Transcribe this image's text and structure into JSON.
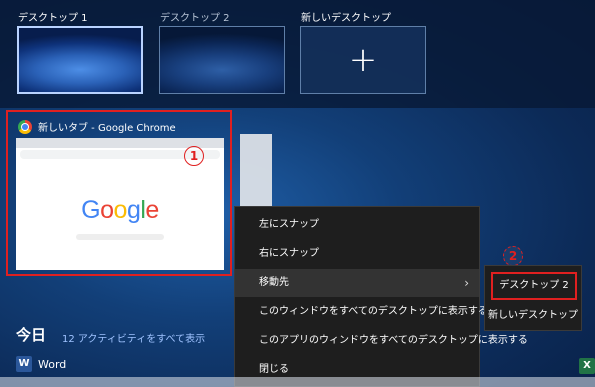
{
  "desktops": [
    {
      "label": "デスクトップ 1"
    },
    {
      "label": "デスクトップ 2"
    },
    {
      "label": "新しいデスクトップ",
      "icon": "plus"
    }
  ],
  "window": {
    "title": "新しいタブ - Google Chrome",
    "icon": "chrome-icon",
    "page_logo": "Google"
  },
  "annotations": {
    "badge1": "1",
    "badge2": "2"
  },
  "context_menu": {
    "items": [
      "左にスナップ",
      "右にスナップ",
      "移動先",
      "このウィンドウをすべてのデスクトップに表示する",
      "このアプリのウィンドウをすべてのデスクトップに表示する",
      "閉じる"
    ],
    "submenu_chevron": "›"
  },
  "submenu": {
    "items": [
      "デスクトップ 2",
      "新しいデスクトップ"
    ]
  },
  "timeline": {
    "title": "今日",
    "link": "12 アクティビティをすべて表示",
    "app": "Word"
  },
  "colors": {
    "highlight": "#e02020",
    "link": "#9fc3ff"
  }
}
